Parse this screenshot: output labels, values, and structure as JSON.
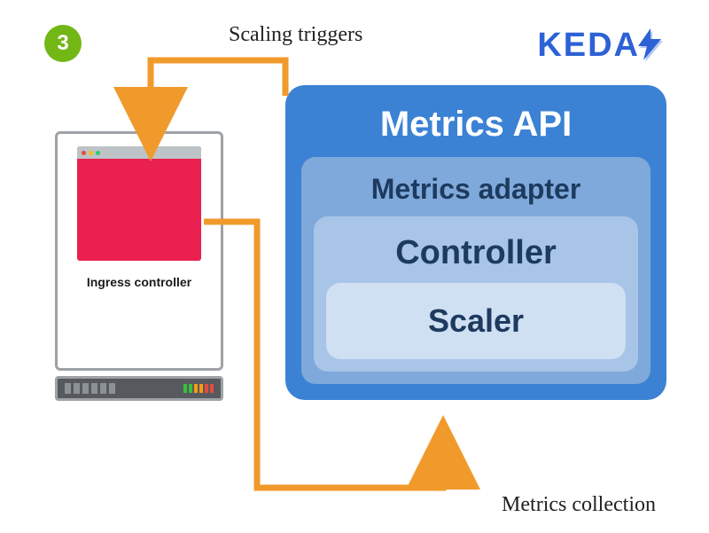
{
  "step": "3",
  "brand": "KEDA",
  "labels": {
    "scaling_triggers": "Scaling triggers",
    "metrics_collection": "Metrics collection"
  },
  "server": {
    "ingress_label": "Ingress controller",
    "window_dots": [
      "#e74c3c",
      "#f1c40f",
      "#2ecc71"
    ]
  },
  "stack": {
    "title": "Metrics API",
    "adapter": "Metrics adapter",
    "controller": "Controller",
    "scaler": "Scaler"
  },
  "colors": {
    "arrow": "#f19a2c",
    "badge": "#73b717",
    "brand": "#2d61d6",
    "stack_outer": "#3b82d4",
    "layer_adapter": "#7fa9da",
    "layer_controller": "#a8c5e8",
    "layer_scaler": "#cfe0f2",
    "app_window": "#e92050"
  }
}
